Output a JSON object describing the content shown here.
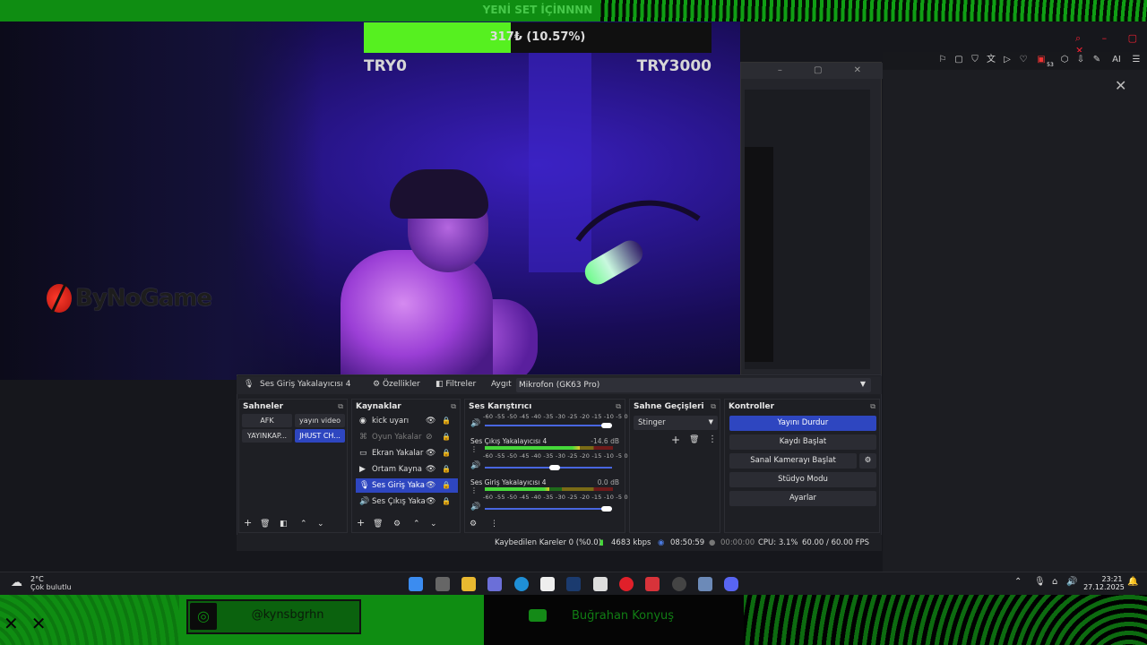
{
  "overlay": {
    "top_title": "YENİ SET İÇİNNNN",
    "goal": {
      "amount_text": "317₺ (10.57%)",
      "min_label": "TRY0",
      "max_label": "TRY3000",
      "progress_fraction": 0.1057,
      "fill_color": "#56f020"
    },
    "brand": "ByNoGame",
    "instagram_handle": "@kynsbgrhn",
    "youtube_name": "Buğrahan Konyuş",
    "accent_color": "#0f8d12"
  },
  "obs": {
    "toolbar": {
      "source_name": "Ses Giriş Yakalayıcısı 4",
      "properties": "Özellikler",
      "filters": "Filtreler",
      "device_label": "Aygıt",
      "device_value": "Mikrofon (GK63 Pro)"
    },
    "scenes": {
      "title": "Sahneler",
      "items": [
        "AFK",
        "yayın video",
        "YAYINKAP...",
        "JHUST CH..."
      ]
    },
    "sources": {
      "title": "Kaynaklar",
      "items": [
        "kick uyarı",
        "Oyun Yakalar",
        "Ekran Yakalar",
        "Ortam Kayna",
        "Ses Giriş Yaka",
        "Ses Çıkış Yaka"
      ]
    },
    "mixer": {
      "title": "Ses Karıştırıcı",
      "scale": "-60 -55 -50 -45 -40 -35 -30 -25 -20 -15 -10 -5 0",
      "channels": [
        {
          "name": "Ses Çıkış Yakalayıcısı 4",
          "db": "-14.6 dB",
          "level": 0.74,
          "volume": 0.56
        },
        {
          "name": "Ses Giriş Yakalayıcısı 4",
          "db": "0.0 dB",
          "level": 0.5,
          "volume": 0.97
        }
      ],
      "top_volume": 0.97
    },
    "transitions": {
      "title": "Sahne Geçişleri",
      "selected": "Stinger"
    },
    "controls": {
      "title": "Kontroller",
      "stop_stream": "Yayını Durdur",
      "start_recording": "Kaydı Başlat",
      "start_virtualcam": "Sanal Kamerayı Başlat",
      "studio_mode": "Stüdyo Modu",
      "settings": "Ayarlar"
    },
    "status": {
      "dropped_frames": "Kaybedilen Kareler 0 (%0.0)",
      "bitrate": "4683 kbps",
      "stream_time": "08:50:59",
      "record_time": "00:00:00",
      "cpu": "CPU: 3.1%",
      "fps": "60.00 / 60.00 FPS"
    }
  },
  "taskbar": {
    "weather_temp": "2°C",
    "weather_desc": "Çok bulutlu",
    "time": "23:21",
    "date": "27.12.2025"
  },
  "browser": {
    "badge_count": "53",
    "ai_label": "AI"
  }
}
